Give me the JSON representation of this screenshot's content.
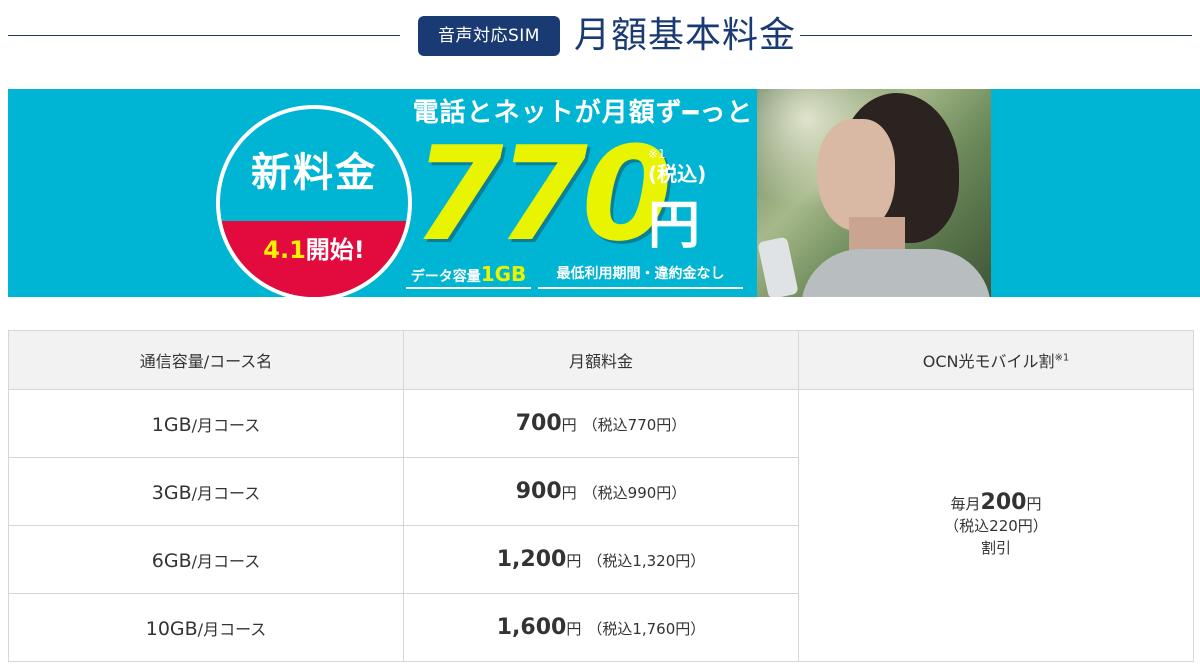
{
  "header": {
    "badge": "音声対応SIM",
    "title": "月額基本料金"
  },
  "banner": {
    "circle_main": "新料金",
    "circle_sub_date": "4.1",
    "circle_sub_text": "開始!",
    "headline": "電話とネットが月額ず━っと",
    "price": "770",
    "note": "※1",
    "tax": "(税込)",
    "yen": "円",
    "caption_data_prefix": "データ容量",
    "caption_data_value": "1GB",
    "caption_terms": "最低利用期間・違約金なし"
  },
  "table": {
    "headers": {
      "course": "通信容量/コース名",
      "monthly": "月額料金",
      "discount": "OCN光モバイル割",
      "discount_note": "※1"
    },
    "rows": [
      {
        "capacity": "1GB",
        "unit": "/月コース",
        "price": "700",
        "yen": "円",
        "tax": "（税込770円）"
      },
      {
        "capacity": "3GB",
        "unit": "/月コース",
        "price": "900",
        "yen": "円",
        "tax": "（税込990円）"
      },
      {
        "capacity": "6GB",
        "unit": "/月コース",
        "price": "1,200",
        "yen": "円",
        "tax": "（税込1,320円）"
      },
      {
        "capacity": "10GB",
        "unit": "/月コース",
        "price": "1,600",
        "yen": "円",
        "tax": "（税込1,760円）"
      }
    ],
    "discount": {
      "prefix": "毎月",
      "amount": "200",
      "yen": "円",
      "tax": "（税込220円）",
      "suffix": "割引"
    }
  },
  "colors": {
    "brand_navy": "#1a3a73",
    "banner_cyan": "#00b5d3",
    "accent_red": "#e30b3d",
    "price_yellow": "#e8f400",
    "header_gray": "#f2f2f2"
  }
}
